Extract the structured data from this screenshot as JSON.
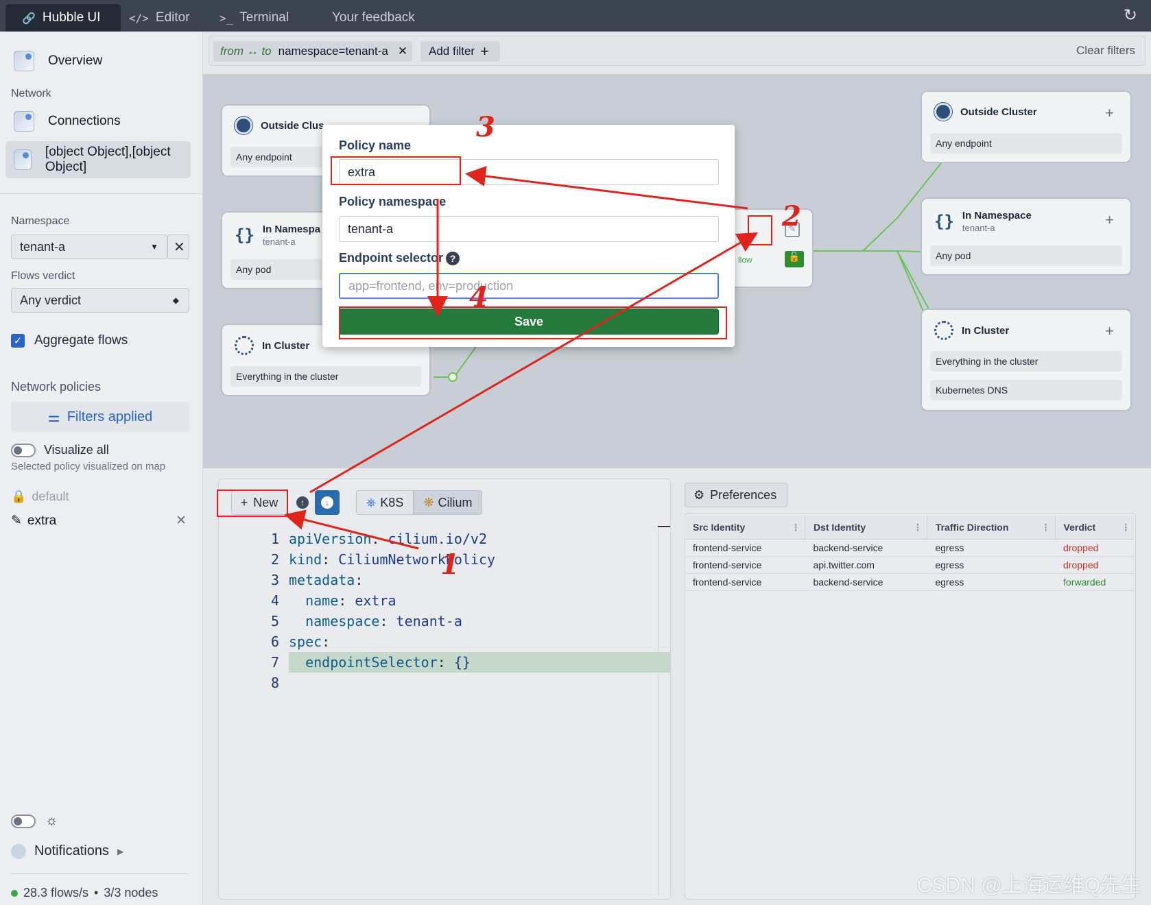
{
  "tabs": [
    {
      "label": "Hubble UI"
    },
    {
      "label": "Editor"
    },
    {
      "label": "Terminal"
    },
    {
      "label": "Your feedback"
    }
  ],
  "sidebar": {
    "overview": "Overview",
    "network_section": "Network",
    "connections": "Connections",
    "policies": [
      {
        "name": "default"
      },
      {
        "name": "extra"
      }
    ],
    "namespace_label": "Namespace",
    "namespace_value": "tenant-a",
    "verdict_label": "Flows verdict",
    "verdict_value": "Any verdict",
    "aggregate_label": "Aggregate flows",
    "network_policies_label": "Network policies",
    "filters_applied": "Filters applied",
    "visualize_all": "Visualize all",
    "visualize_hint": "Selected policy visualized on map",
    "notifications": "Notifications",
    "flows_rate": "28.3 flows/s",
    "separator": "•",
    "nodes": "3/3 nodes"
  },
  "filterbar": {
    "direction": "from ↔ to",
    "filter": "namespace=tenant-a",
    "add_filter": "Add filter",
    "clear_filters": "Clear filters"
  },
  "map": {
    "left_cards": [
      {
        "title": "Outside Clus",
        "rows": [
          "Any endpoint"
        ]
      },
      {
        "title": "In Namespa",
        "subtitle": "tenant-a",
        "rows": [
          "Any pod"
        ]
      },
      {
        "title": "In Cluster",
        "rows": [
          "Everything in the cluster"
        ]
      }
    ],
    "right_cards": [
      {
        "title": "Outside Cluster",
        "rows": [
          "Any endpoint"
        ]
      },
      {
        "title": "In Namespace",
        "subtitle": "tenant-a",
        "rows": [
          "Any pod"
        ]
      },
      {
        "title": "In Cluster",
        "rows": [
          "Everything in the cluster",
          "Kubernetes DNS"
        ]
      }
    ],
    "center_fragment": "llow"
  },
  "modal": {
    "policy_name_label": "Policy name",
    "policy_name_value": "extra",
    "namespace_label": "Policy namespace",
    "namespace_value": "tenant-a",
    "selector_label": "Endpoint selector",
    "selector_placeholder": "app=frontend, env=production",
    "save_label": "Save"
  },
  "editor": {
    "new_label": "New",
    "k8s_label": "K8S",
    "cilium_label": "Cilium",
    "lines": [
      {
        "n": "1",
        "key": "apiVersion",
        "val": "cilium.io/v2"
      },
      {
        "n": "2",
        "key": "kind",
        "val": "CiliumNetworkPolicy"
      },
      {
        "n": "3",
        "key": "metadata",
        "val": ""
      },
      {
        "n": "4",
        "key": "  name",
        "val": "extra"
      },
      {
        "n": "5",
        "key": "  namespace",
        "val": "tenant-a"
      },
      {
        "n": "6",
        "key": "spec",
        "val": ""
      },
      {
        "n": "7",
        "key": "  endpointSelector",
        "val": "{}"
      },
      {
        "n": "8",
        "key": "",
        "val": ""
      }
    ]
  },
  "flows": {
    "preferences": "Preferences",
    "columns": [
      "Src Identity",
      "Dst Identity",
      "Traffic Direction",
      "Verdict"
    ],
    "rows": [
      [
        "frontend-service",
        "backend-service",
        "egress",
        "dropped"
      ],
      [
        "frontend-service",
        "api.twitter.com",
        "egress",
        "dropped"
      ],
      [
        "frontend-service",
        "backend-service",
        "egress",
        "forwarded"
      ]
    ]
  },
  "annotations": [
    "1",
    "2",
    "3",
    "4"
  ],
  "watermark": "CSDN @上海运维Q先生",
  "colors": {
    "accent": "#2a64c8",
    "save": "#237a3a",
    "dropped": "#c4302b",
    "forwarded": "#2d8c2d",
    "annotation": "#e0241b"
  }
}
